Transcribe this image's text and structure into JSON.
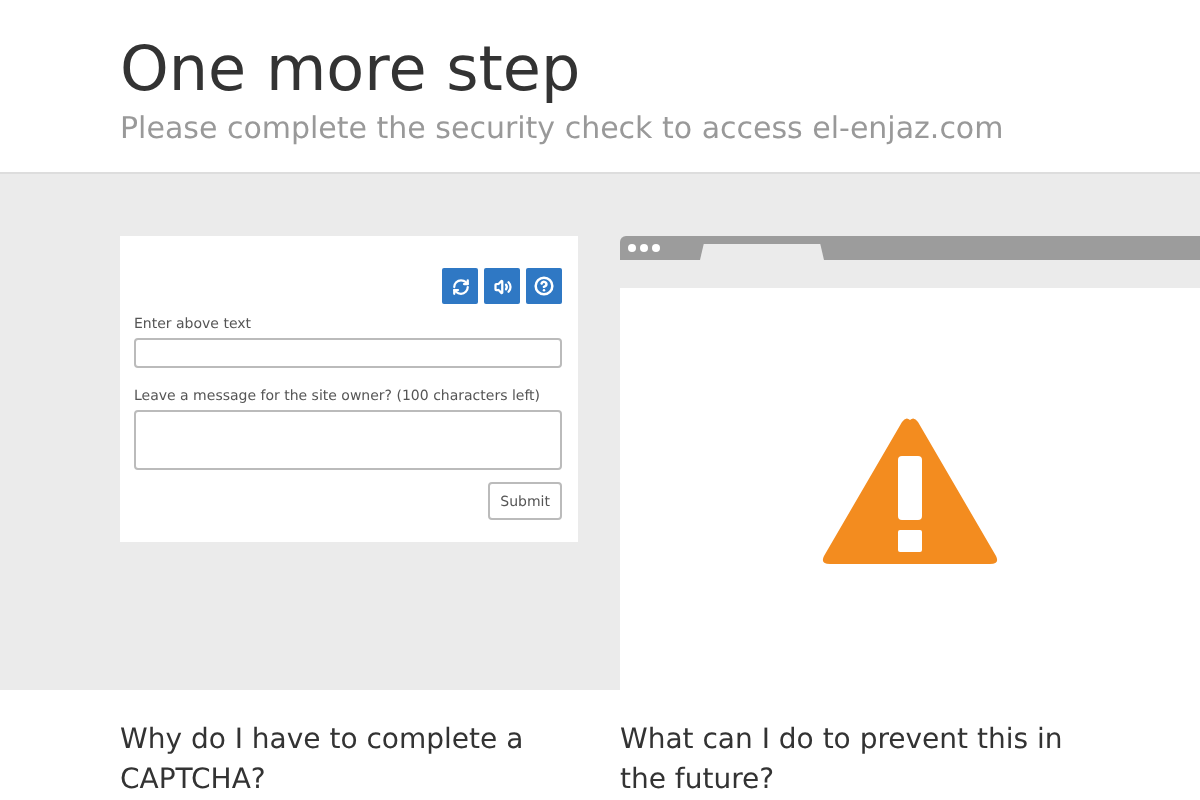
{
  "header": {
    "title": "One more step",
    "subtitle": "Please complete the security check to access el-enjaz.com"
  },
  "captcha": {
    "text_label": "Enter above text",
    "message_label": "Leave a message for the site owner? (100 characters left)",
    "submit": "Submit"
  },
  "questions": [
    "Why do I have to complete a CAPTCHA?",
    "What can I do to prevent this in the future?"
  ]
}
